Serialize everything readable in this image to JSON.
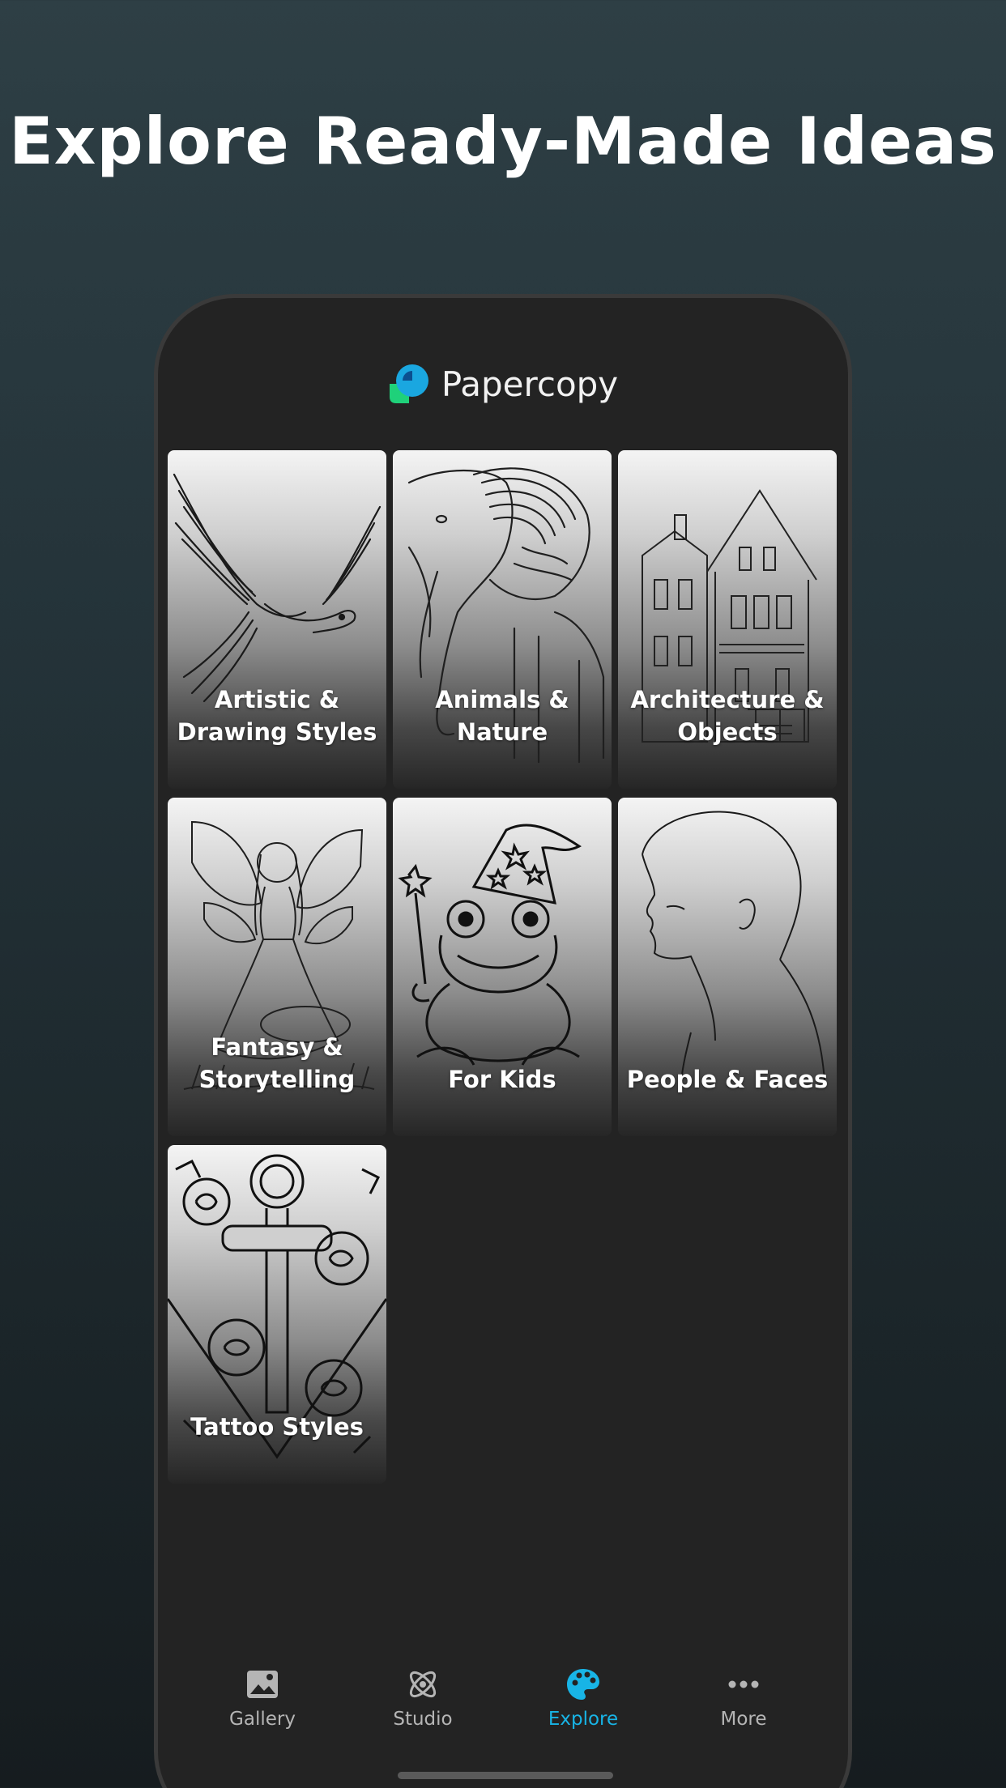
{
  "headline": "Explore Ready-Made Ideas",
  "app": {
    "brand": "Papercopy"
  },
  "categories": [
    {
      "label": "Artistic & Drawing Styles",
      "icon": "eagle-illustration"
    },
    {
      "label": "Animals & Nature",
      "icon": "elephant-illustration"
    },
    {
      "label": "Architecture & Objects",
      "icon": "house-illustration"
    },
    {
      "label": "Fantasy & Storytelling",
      "icon": "fairy-illustration"
    },
    {
      "label": "For Kids",
      "icon": "frog-wizard-illustration"
    },
    {
      "label": "People & Faces",
      "icon": "face-profile-illustration"
    },
    {
      "label": "Tattoo Styles",
      "icon": "anchor-roses-illustration"
    }
  ],
  "tabs": [
    {
      "label": "Gallery",
      "icon": "image-icon",
      "active": false
    },
    {
      "label": "Studio",
      "icon": "atom-icon",
      "active": false
    },
    {
      "label": "Explore",
      "icon": "palette-icon",
      "active": true
    },
    {
      "label": "More",
      "icon": "more-icon",
      "active": false
    }
  ],
  "colors": {
    "accent": "#18b4e6",
    "tab_inactive": "#b5b5b5",
    "phone_bg": "#232323"
  }
}
